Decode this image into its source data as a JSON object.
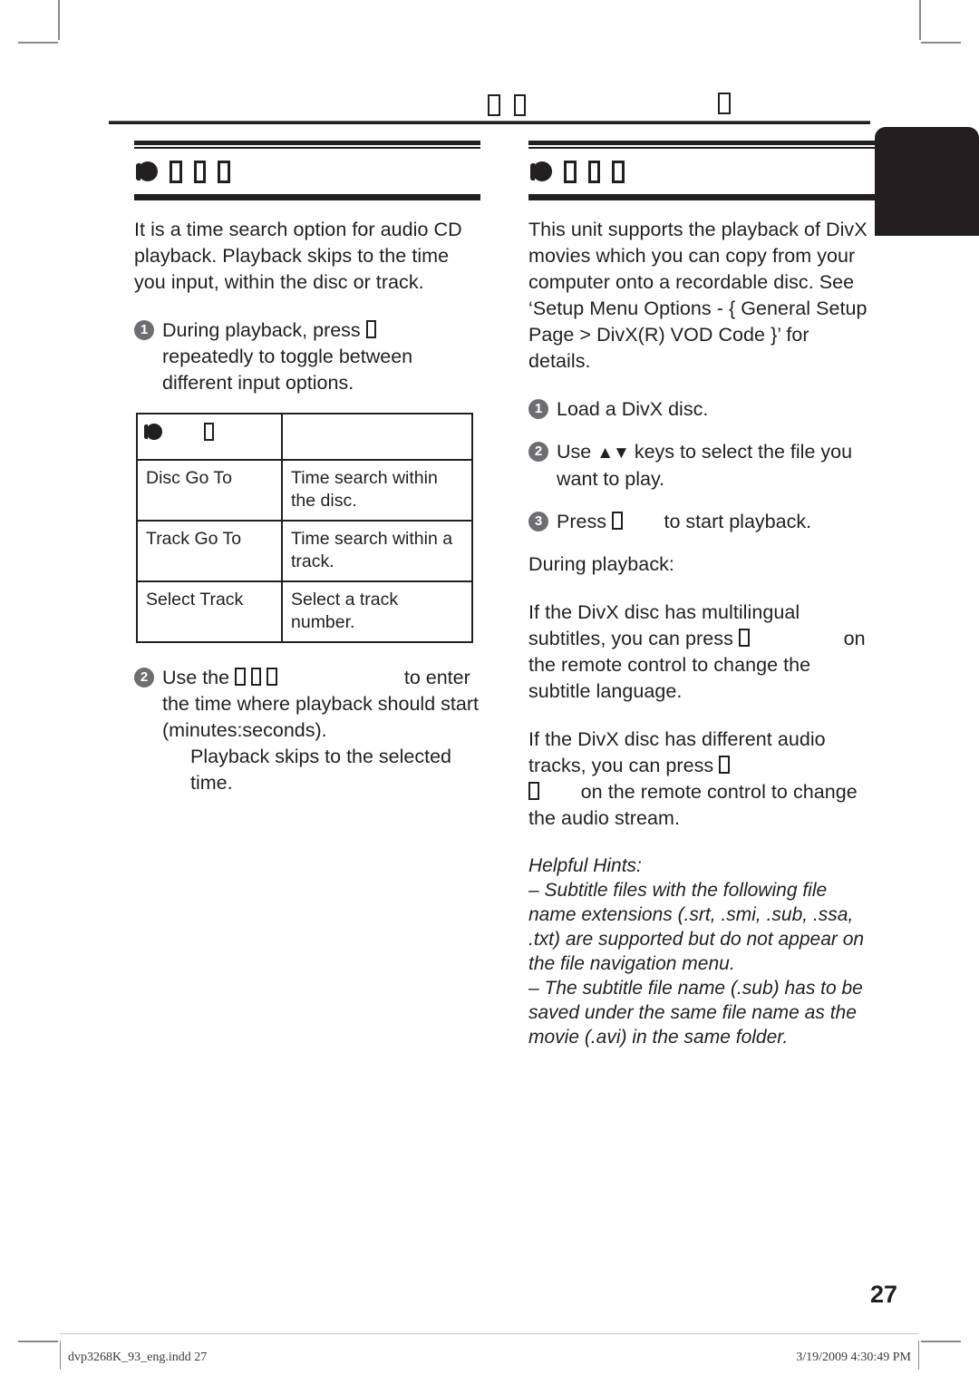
{
  "document": {
    "page_number": "27",
    "running_head": {
      "left_glyphs": [
        "tofu",
        "tofu"
      ],
      "right_glyphs": [
        "tofu"
      ]
    },
    "footer": {
      "file_name": "dvp3268K_93_eng.indd   27",
      "timestamp": "3/19/2009   4:30:49 PM"
    }
  },
  "left_column": {
    "heading": {
      "disc_glyph": "disc-icon",
      "glyphs": [
        "tofu",
        "tofu",
        "tofu"
      ]
    },
    "intro": "It is a time search option for audio CD playback. Playback skips to the time you input, within the disc or track.",
    "steps": [
      {
        "number": "1",
        "text_before": "During playback, press",
        "glyph": "tofu",
        "text_after": "repeatedly to toggle between different input options."
      },
      {
        "number": "2",
        "text_before": "Use the",
        "glyphs": [
          "tofu",
          "tofu",
          "tofu"
        ],
        "text_after": "to enter the time where playback should start (minutes:seconds).",
        "sub_text": "Playback skips to the selected time."
      }
    ],
    "table": {
      "header": {
        "col1_disc_glyph": "disc-icon",
        "col1_glyph": "tofu",
        "col2": ""
      },
      "rows": [
        {
          "option": "Disc Go To",
          "description": "Time search within the disc."
        },
        {
          "option": "Track Go To",
          "description": "Time search within a track."
        },
        {
          "option": "Select Track",
          "description": "Select a track number."
        }
      ]
    }
  },
  "right_column": {
    "heading": {
      "disc_glyph": "disc-icon",
      "glyphs": [
        "tofu",
        "tofu",
        "tofu"
      ]
    },
    "intro": "This unit supports the playback of DivX movies which you can copy from your computer onto a recordable disc. See ‘Setup Menu Options - { General Setup Page > DivX(R) VOD Code }’ for details.",
    "steps": [
      {
        "number": "1",
        "text": "Load a DivX disc."
      },
      {
        "number": "2",
        "text_before": "Use",
        "keys": "▲▼",
        "text_after": "keys to select the file you want to play."
      },
      {
        "number": "3",
        "text_before": "Press",
        "glyph": "tofu",
        "text_after": "to start playback."
      }
    ],
    "during_playback_label": "During playback:",
    "subtitle_note": {
      "part1": "If the DivX disc has multilingual subtitles, you can press",
      "glyph": "tofu",
      "part2": "on the remote control to change the subtitle language."
    },
    "audio_note": {
      "part1": "If the DivX disc has different audio tracks, you can press",
      "glyph1": "tofu",
      "glyph2": "tofu",
      "part2": "on the remote control to change the audio stream."
    },
    "hints": {
      "title": "Helpful Hints:",
      "items": [
        "–  Subtitle files with the following file name extensions (.srt, .smi, .sub, .ssa, .txt) are supported but do not appear on the file navigation menu.",
        "–  The subtitle file name (.sub) has to be saved under the same file name as the movie (.avi) in the same folder."
      ]
    }
  }
}
